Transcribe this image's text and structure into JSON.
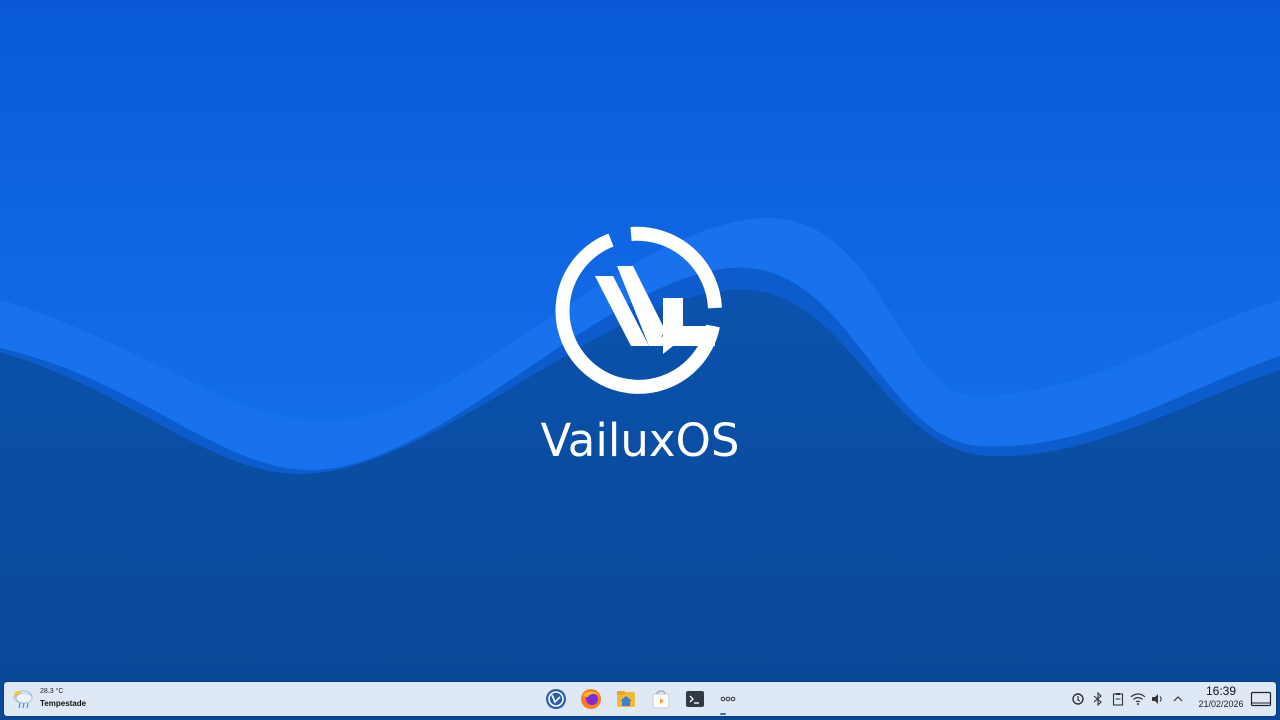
{
  "desktop": {
    "brand_name": "VailuxOS",
    "colors": {
      "sky_top": "#0a63e6",
      "wave_light": "#1f7cf4",
      "wave_band": "#1468dc",
      "ground": "#0a4fa6",
      "logo": "#ffffff"
    }
  },
  "taskbar": {
    "weather": {
      "temperature": "28.3 °C",
      "condition": "Tempestade",
      "icon": "thunderstorm-icon"
    },
    "tasks": [
      {
        "name": "vailux-menu",
        "icon": "vailux-logo-icon"
      },
      {
        "name": "firefox",
        "icon": "firefox-icon"
      },
      {
        "name": "file-manager",
        "icon": "home-folder-icon"
      },
      {
        "name": "store",
        "icon": "store-bag-icon"
      },
      {
        "name": "terminal",
        "icon": "terminal-icon"
      },
      {
        "name": "more",
        "icon": "more-dots-icon"
      }
    ],
    "tray": {
      "icons": [
        "update-icon",
        "bluetooth-icon",
        "clipboard-icon",
        "wifi-icon",
        "volume-icon",
        "chevron-up-icon"
      ]
    },
    "clock": {
      "time": "16:39",
      "date": "21/02/2026"
    }
  }
}
